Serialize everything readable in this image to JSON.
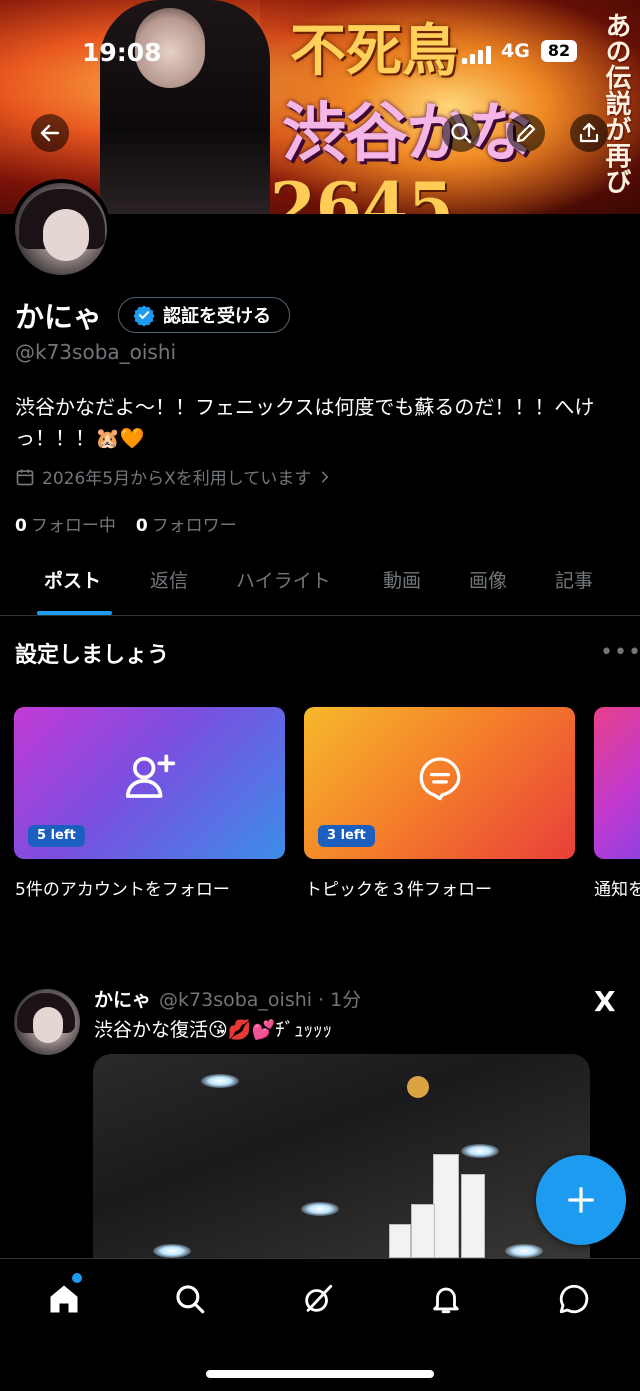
{
  "status_bar": {
    "time": "19:08",
    "network": "4G",
    "battery": "82"
  },
  "banner": {
    "line1": "不死鳥",
    "line2": "渋谷かな",
    "line3": "2645",
    "side": "あの伝説が再び"
  },
  "profile": {
    "display_name": "かにゃ",
    "verify_label": "認証を受ける",
    "handle": "@k73soba_oishi",
    "bio": "渋谷かなだよ〜！！フェニックスは何度でも蘇るのだ！！！へけっ！！！🐹🧡",
    "joined": "2026年5月からXを利用しています",
    "following_count": "0",
    "following_label": "フォロー中",
    "followers_count": "0",
    "followers_label": "フォロワー"
  },
  "tabs": [
    "ポスト",
    "返信",
    "ハイライト",
    "動画",
    "画像",
    "記事"
  ],
  "setup": {
    "title": "設定しましょう",
    "more": "•••",
    "cards": [
      {
        "pill": "5 left",
        "caption": "5件のアカウントをフォロー",
        "icon": "add-user-icon"
      },
      {
        "pill": "3 left",
        "caption": "トピックを３件フォロー",
        "icon": "topic-icon"
      },
      {
        "pill": "",
        "caption": "通知を",
        "icon": ""
      }
    ]
  },
  "post": {
    "name": "かにゃ",
    "handle_time": "@k73soba_oishi · 1分",
    "text": "渋谷かな復活😘💋💕ﾁﾞｭｯｯｯ",
    "x_label": "X"
  },
  "colors": {
    "accent": "#1d9bf0",
    "background": "#000000",
    "muted": "#71767b"
  },
  "bottom_nav": [
    "home-icon",
    "search-icon",
    "grok-icon",
    "notifications-icon",
    "messages-icon"
  ]
}
